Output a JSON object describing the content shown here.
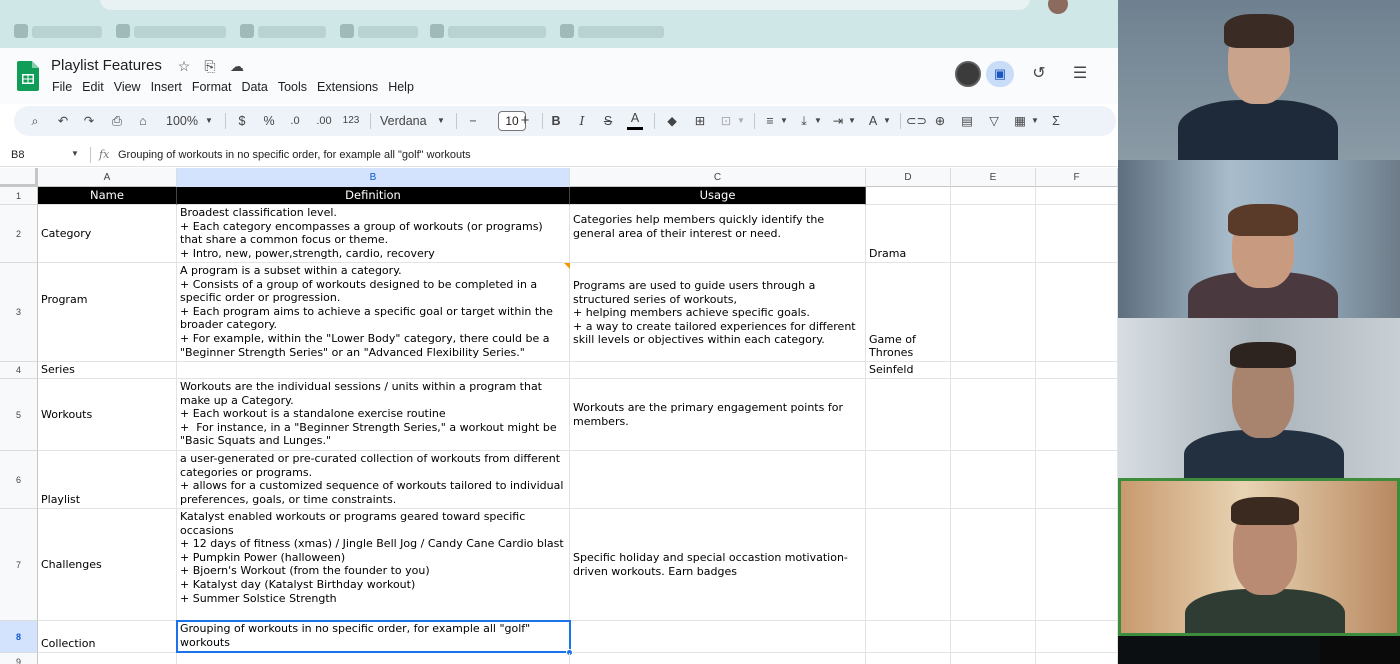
{
  "doc": {
    "title": "Playlist Features",
    "menus": [
      "File",
      "Edit",
      "View",
      "Insert",
      "Format",
      "Data",
      "Tools",
      "Extensions",
      "Help"
    ]
  },
  "toolbar": {
    "zoom": "100%",
    "currency": "$",
    "percent": "%",
    "dec_decrease": ".0",
    "dec_increase": ".00",
    "number_format": "123",
    "font": "Verdana",
    "font_size": "10",
    "minus": "−",
    "plus": "+",
    "bold": "B",
    "italic": "I",
    "strike": "S",
    "text_color": "A",
    "sigma": "Σ"
  },
  "formula_bar": {
    "cell_ref": "B8",
    "fx": "fx",
    "content": "Grouping of workouts in no specific order, for example all \"golf\" workouts"
  },
  "columns": [
    "A",
    "B",
    "C",
    "D",
    "E",
    "F"
  ],
  "rows": [
    {
      "num": "1",
      "a": "Name",
      "b": "Definition",
      "c": "Usage",
      "d": ""
    },
    {
      "num": "2",
      "a": "Category",
      "b": "Broadest classification level.\n+ Each category encompasses a group of workouts (or programs) that share a common focus or theme.\n+ Intro, new, power,strength, cardio, recovery",
      "c": "Categories help members quickly identify the general area of their interest or need.",
      "d": "Drama"
    },
    {
      "num": "3",
      "a": "Program",
      "b": "A program is a subset within a category.\n+ Consists of a group of workouts designed to be completed in a specific order or progression.\n+ Each program aims to achieve a specific goal or target within the broader category.\n+ For example, within the \"Lower Body\" category, there could be a \"Beginner Strength Series\" or an \"Advanced Flexibility Series.\"",
      "c": "Programs are used to guide users through a structured series of workouts,\n+ helping members achieve specific goals.\n+ a way to create tailored experiences for different skill levels or objectives within each category.",
      "d": "Game of\nThrones"
    },
    {
      "num": "4",
      "a": "Series",
      "b": "",
      "c": "",
      "d": "Seinfeld"
    },
    {
      "num": "5",
      "a": "Workouts",
      "b": "Workouts are the individual sessions / units within a program that make up a Category.\n+ Each workout is a standalone exercise routine\n+  For instance, in a \"Beginner Strength Series,\" a workout might be \"Basic Squats and Lunges.\"",
      "c": "Workouts are the primary engagement points for members.",
      "d": ""
    },
    {
      "num": "6",
      "a": "Playlist",
      "b": "a user-generated or pre-curated collection of workouts from different categories or programs.\n+ allows for a customized sequence of workouts tailored to individual preferences, goals, or time constraints.",
      "c": "",
      "d": ""
    },
    {
      "num": "7",
      "a": "Challenges",
      "b": "Katalyst enabled workouts or programs geared toward specific occasions\n+ 12 days of fitness (xmas) / Jingle Bell Jog / Candy Cane Cardio blast\n+ Pumpkin Power (halloween)\n+ Bjoern's Workout (from the founder to you)\n+ Katalyst day (Katalyst Birthday workout)\n+ Summer Solstice Strength",
      "c": "Specific holiday and special occastion motivation-driven workouts. Earn badges",
      "d": ""
    },
    {
      "num": "8",
      "a": "Collection",
      "b": "Grouping of workouts in no specific order, for example all \"golf\" workouts",
      "c": "",
      "d": ""
    },
    {
      "num": "9",
      "a": "",
      "b": "",
      "c": "",
      "d": ""
    }
  ],
  "video": {
    "participants": [
      {
        "id": "p1",
        "bg": "#7c8e9a"
      },
      {
        "id": "p2",
        "bg": "#8aa0b4"
      },
      {
        "id": "p3",
        "bg": "#b7bec3"
      },
      {
        "id": "p4",
        "bg": "#b69e82"
      }
    ]
  }
}
